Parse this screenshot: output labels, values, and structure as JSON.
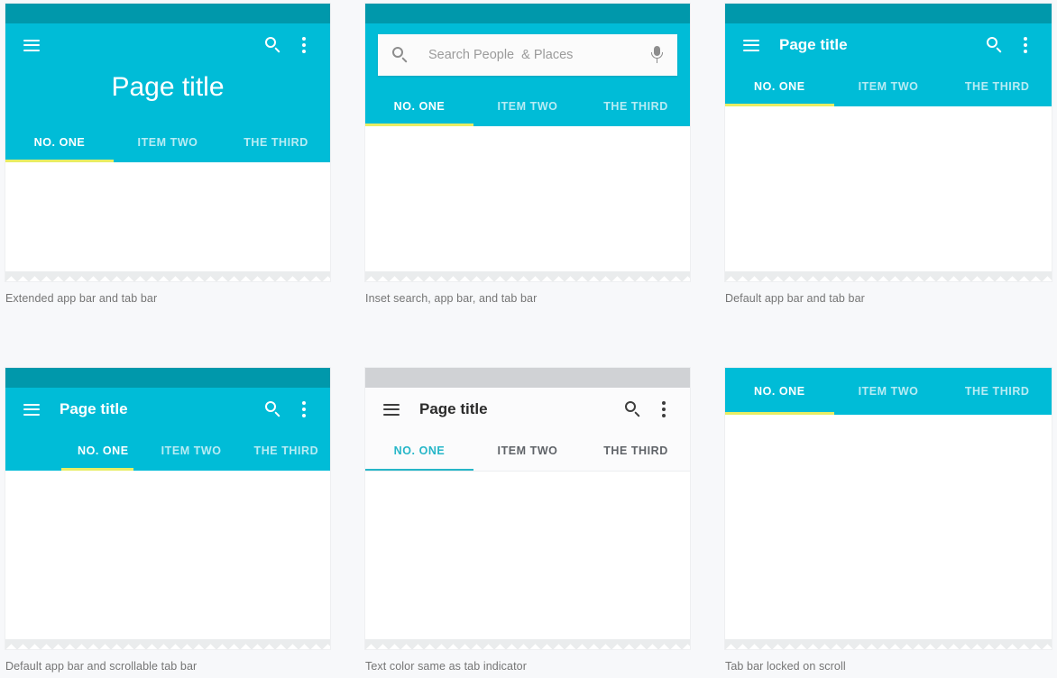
{
  "theme": {
    "primary": "#00bcd7",
    "primary_dark": "#0098ab",
    "indicator_yellow": "#e8ed63",
    "indicator_teal": "#26b6c8",
    "status_gray": "#d0d2d5",
    "page_background": "#f7f8fa",
    "caption_color": "#757575"
  },
  "common": {
    "page_title": "Page title",
    "tabs": [
      "NO. ONE",
      "ITEM TWO",
      "THE THIRD"
    ],
    "active_tab_index": 0,
    "icons": {
      "menu": "hamburger-icon",
      "search": "search-icon",
      "overflow": "overflow-menu-icon",
      "mic": "microphone-icon"
    }
  },
  "panels": [
    {
      "id": "extended-app-bar",
      "caption": "Extended app bar and tab bar",
      "title": "Page title",
      "tabs": [
        "NO. ONE",
        "ITEM TWO",
        "THE THIRD"
      ],
      "active_tab": "NO. ONE",
      "style": "teal",
      "tab_mode": "fixed",
      "indicator_color": "#e8ed63"
    },
    {
      "id": "inset-search-app-bar",
      "caption": "Inset search, app bar, and tab bar",
      "search_placeholder": "Search People  & Places",
      "search_value": "",
      "tabs": [
        "NO. ONE",
        "ITEM TWO",
        "THE THIRD"
      ],
      "active_tab": "NO. ONE",
      "style": "teal",
      "tab_mode": "fixed",
      "indicator_color": "#e8ed63"
    },
    {
      "id": "default-app-bar",
      "caption": "Default app bar and tab bar",
      "title": "Page title",
      "tabs": [
        "NO. ONE",
        "ITEM TWO",
        "THE THIRD"
      ],
      "active_tab": "NO. ONE",
      "style": "teal",
      "tab_mode": "fixed",
      "indicator_color": "#e8ed63"
    },
    {
      "id": "scrollable-tab-bar",
      "caption": "Default app bar and scrollable tab bar",
      "title": "Page title",
      "tabs": [
        "NO. ONE",
        "ITEM TWO",
        "THE THIRD"
      ],
      "active_tab": "NO. ONE",
      "style": "teal",
      "tab_mode": "scrollable",
      "indicator_color": "#e8ed63"
    },
    {
      "id": "text-color-same-as-indicator",
      "caption": "Text color same as tab indicator",
      "title": "Page title",
      "tabs": [
        "NO. ONE",
        "ITEM TWO",
        "THE THIRD"
      ],
      "active_tab": "NO. ONE",
      "style": "light",
      "tab_mode": "fixed",
      "indicator_color": "#26b6c8"
    },
    {
      "id": "tab-bar-locked-on-scroll",
      "caption": "Tab bar locked on scroll",
      "tabs": [
        "NO. ONE",
        "ITEM TWO",
        "THE THIRD"
      ],
      "active_tab": "NO. ONE",
      "style": "teal",
      "tab_mode": "fixed",
      "indicator_color": "#e8ed63"
    }
  ]
}
